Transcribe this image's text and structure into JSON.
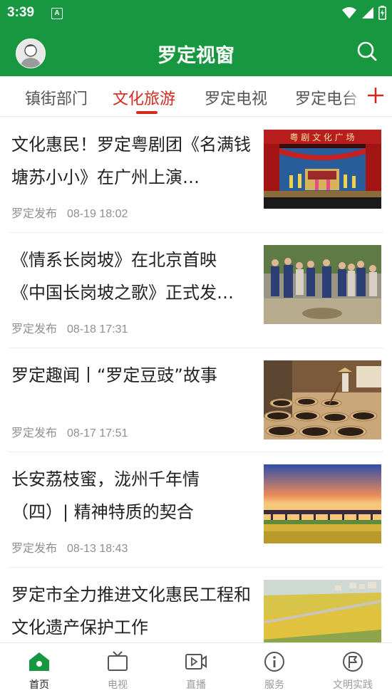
{
  "status_bar": {
    "time": "3:39",
    "notification_badge": "A"
  },
  "app_bar": {
    "title": "罗定视窗"
  },
  "tabs": [
    {
      "label": "镇街部门",
      "active": false
    },
    {
      "label": "文化旅游",
      "active": true
    },
    {
      "label": "罗定电视",
      "active": false
    },
    {
      "label": "罗定电台",
      "active": false
    }
  ],
  "articles": [
    {
      "title": "文化惠民！罗定粤剧团《名满钱塘苏小小》在广州上演…",
      "source": "罗定发布",
      "time": "08-19 18:02",
      "thumb_text": "粤 剧 文 化 广 场"
    },
    {
      "title": "《情系长岗坡》在北京首映 《中国长岗坡之歌》正式发…",
      "source": "罗定发布",
      "time": "08-18 17:31"
    },
    {
      "title": "罗定趣闻丨“罗定豆豉”故事",
      "source": "罗定发布",
      "time": "08-17 17:51"
    },
    {
      "title": "长安荔枝蜜，泷州千年情（四）| 精神特质的契合",
      "source": "罗定发布",
      "time": "08-13 18:43"
    },
    {
      "title": "罗定市全力推进文化惠民工程和文化遗产保护工作",
      "source": "",
      "time": ""
    }
  ],
  "bottom_nav": [
    {
      "label": "首页",
      "icon": "home-icon",
      "active": true
    },
    {
      "label": "电视",
      "icon": "tv-icon",
      "active": false
    },
    {
      "label": "直播",
      "icon": "live-video-icon",
      "active": false
    },
    {
      "label": "服务",
      "icon": "info-icon",
      "active": false
    },
    {
      "label": "文明实践",
      "icon": "flag-badge-icon",
      "active": false
    }
  ],
  "colors": {
    "brand_green": "#17973f",
    "active_red": "#d7281e",
    "muted_gray": "#8f8f8f"
  }
}
